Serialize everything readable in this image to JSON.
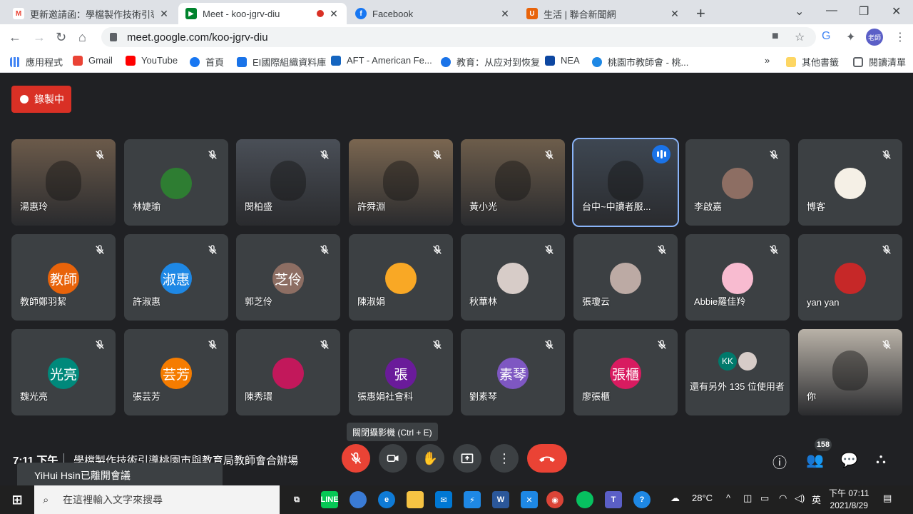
{
  "browser": {
    "tabs": [
      {
        "title": "更新邀請函：學檔製作技術引導",
        "favicon": "gmail"
      },
      {
        "title": "Meet - koo-jgrv-diu",
        "favicon": "meet",
        "active": true
      },
      {
        "title": "Facebook",
        "favicon": "facebook"
      },
      {
        "title": "生活 | 聯合新聞網",
        "favicon": "udn"
      }
    ],
    "url": "meet.google.com/koo-jgrv-diu",
    "profile_label": "老師",
    "bookmarks": [
      {
        "label": "應用程式"
      },
      {
        "label": "Gmail"
      },
      {
        "label": "YouTube"
      },
      {
        "label": "首頁"
      },
      {
        "label": "EI國際組織資料庫"
      },
      {
        "label": "AFT - American Fe..."
      },
      {
        "label": "教育：从应对到恢复"
      },
      {
        "label": "NEA"
      },
      {
        "label": "桃園市教師會 - 桃..."
      }
    ],
    "other_bookmarks": "其他書籤",
    "reading_list": "閱讀清單"
  },
  "meet": {
    "recording_label": "錄製中",
    "participants": [
      {
        "name": "湯惠玲",
        "type": "video",
        "bg": "#6b5a4a"
      },
      {
        "name": "林婕瑜",
        "type": "avatar",
        "initials": "",
        "color": "#2e7d32"
      },
      {
        "name": "閔柏盛",
        "type": "video",
        "bg": "#4a4f57"
      },
      {
        "name": "許舜淵",
        "type": "video",
        "bg": "#7a6650"
      },
      {
        "name": "黃小光",
        "type": "video",
        "bg": "#6d5d4b"
      },
      {
        "name": "台中~中讀者服...",
        "type": "video",
        "bg": "#3e4752",
        "speaking": true
      },
      {
        "name": "李啟嘉",
        "type": "avatar",
        "initials": "",
        "color": "#8d6e63"
      },
      {
        "name": "博客",
        "type": "avatar",
        "initials": "",
        "color": "#f5f0e6"
      },
      {
        "name": "教師鄭羽絜",
        "type": "avatar",
        "initials": "教師",
        "color": "#e8630a"
      },
      {
        "name": "許淑惠",
        "type": "avatar",
        "initials": "淑惠",
        "color": "#1e88e5"
      },
      {
        "name": "郭芝伶",
        "type": "avatar",
        "initials": "芝伶",
        "color": "#8d6e63"
      },
      {
        "name": "陳淑娟",
        "type": "avatar",
        "initials": "",
        "color": "#f9a825"
      },
      {
        "name": "秋華林",
        "type": "avatar",
        "initials": "",
        "color": "#d7ccc8"
      },
      {
        "name": "張瓊云",
        "type": "avatar",
        "initials": "",
        "color": "#bcaaa4"
      },
      {
        "name": "Abbie羅佳羚",
        "type": "avatar",
        "initials": "",
        "color": "#f8bbd0"
      },
      {
        "name": "yan yan",
        "type": "avatar",
        "initials": "",
        "color": "#c62828"
      },
      {
        "name": "魏光亮",
        "type": "avatar",
        "initials": "光亮",
        "color": "#00897b"
      },
      {
        "name": "張芸芳",
        "type": "avatar",
        "initials": "芸芳",
        "color": "#f57c00"
      },
      {
        "name": "陳秀環",
        "type": "avatar",
        "initials": "",
        "color": "#c2185b"
      },
      {
        "name": "張惠娟社會科",
        "type": "avatar",
        "initials": "張",
        "color": "#6a1b9a"
      },
      {
        "name": "劉素琴",
        "type": "avatar",
        "initials": "素琴",
        "color": "#7e57c2"
      },
      {
        "name": "廖張櫃",
        "type": "avatar",
        "initials": "張櫃",
        "color": "#d81b60"
      },
      {
        "name": "還有另外 135 位使用者",
        "type": "others",
        "initials": "KK",
        "color": "#00796b"
      },
      {
        "name": "你",
        "type": "video",
        "bg": "#b9b2a8"
      }
    ],
    "tooltip": "關閉攝影機 (Ctrl + E)",
    "time": "7:11 下午",
    "meeting_title": "學檔製作技術引導桃園市與教育局教師會合辦場",
    "participant_count": "158",
    "toast": "YiHui Hsin已離開會議"
  },
  "taskbar": {
    "search_placeholder": "在這裡輸入文字來搜尋",
    "temperature": "28°C",
    "ime": "英",
    "clock_time": "下午 07:11",
    "clock_date": "2021/8/29"
  }
}
